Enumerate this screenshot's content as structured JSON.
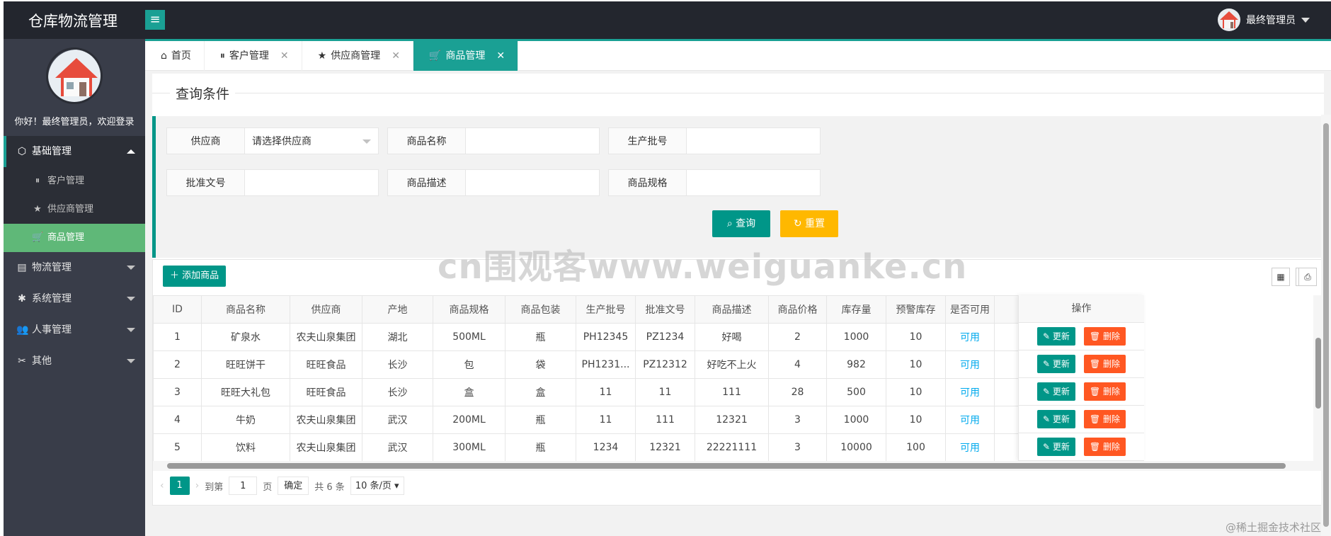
{
  "app": {
    "title": "仓库物流管理",
    "menu_toggle": "≡"
  },
  "user": {
    "name": "最终管理员",
    "welcome": "你好！最终管理员，欢迎登录"
  },
  "sidebar": {
    "groups": [
      {
        "icon": "⬡",
        "label": "基础管理",
        "open": true
      },
      {
        "icon": "▤",
        "label": "物流管理"
      },
      {
        "icon": "✱",
        "label": "系统管理"
      },
      {
        "icon": "👥",
        "label": "人事管理"
      },
      {
        "icon": "✂",
        "label": "其他"
      }
    ],
    "sub_items": [
      {
        "icon": "⏸",
        "label": "客户管理"
      },
      {
        "icon": "★",
        "label": "供应商管理"
      },
      {
        "icon": "🛒",
        "label": "商品管理",
        "active": true
      }
    ]
  },
  "tabs": [
    {
      "icon": "⌂",
      "label": "首页"
    },
    {
      "icon": "⏸",
      "label": "客户管理",
      "close": "✕"
    },
    {
      "icon": "★",
      "label": "供应商管理",
      "close": "✕"
    },
    {
      "icon": "🛒",
      "label": "商品管理",
      "close": "✕",
      "active": true
    }
  ],
  "query": {
    "legend": "查询条件",
    "fields": [
      {
        "label": "供应商",
        "value": "请选择供应商"
      },
      {
        "label": "商品名称",
        "value": ""
      },
      {
        "label": "生产批号",
        "value": ""
      },
      {
        "label": "批准文号",
        "value": ""
      },
      {
        "label": "商品描述",
        "value": ""
      },
      {
        "label": "商品规格",
        "value": ""
      }
    ],
    "search_label": "查询",
    "reset_label": "重置"
  },
  "table": {
    "add_label": "添加商品",
    "tool_icons": [
      "columns-icon",
      "export-icon",
      "print-icon"
    ],
    "columns": [
      "ID",
      "商品名称",
      "供应商",
      "产地",
      "商品规格",
      "商品包装",
      "生产批号",
      "批准文号",
      "商品描述",
      "商品价格",
      "库存量",
      "预警库存",
      "是否可用",
      "操作"
    ],
    "rows": [
      [
        "1",
        "矿泉水",
        "农夫山泉集团",
        "湖北",
        "500ML",
        "瓶",
        "PH12345",
        "PZ1234",
        "好喝",
        "2",
        "1000",
        "10",
        "可用"
      ],
      [
        "2",
        "旺旺饼干",
        "旺旺食品",
        "长沙",
        "包",
        "袋",
        "PH1231...",
        "PZ12312",
        "好吃不上火",
        "4",
        "982",
        "10",
        "可用"
      ],
      [
        "3",
        "旺旺大礼包",
        "旺旺食品",
        "长沙",
        "盒",
        "盒",
        "11",
        "11",
        "111",
        "28",
        "500",
        "10",
        "可用"
      ],
      [
        "4",
        "牛奶",
        "农夫山泉集团",
        "武汉",
        "200ML",
        "瓶",
        "11",
        "111",
        "12321",
        "3",
        "1000",
        "10",
        "可用"
      ],
      [
        "5",
        "饮料",
        "农夫山泉集团",
        "武汉",
        "300ML",
        "瓶",
        "1234",
        "12321",
        "22221111",
        "3",
        "10000",
        "100",
        "可用"
      ]
    ],
    "edit_label": "更新",
    "delete_label": "删除"
  },
  "pager": {
    "prev": "‹",
    "current": "1",
    "next": "›",
    "goto_label": "到第",
    "goto_value": "1",
    "page_label": "页",
    "confirm_label": "确定",
    "total": "共 6 条",
    "page_size": "10 条/页"
  },
  "watermark": "cn围观客www.weiguanke.cn",
  "footnote": "@稀土掘金技术社区"
}
